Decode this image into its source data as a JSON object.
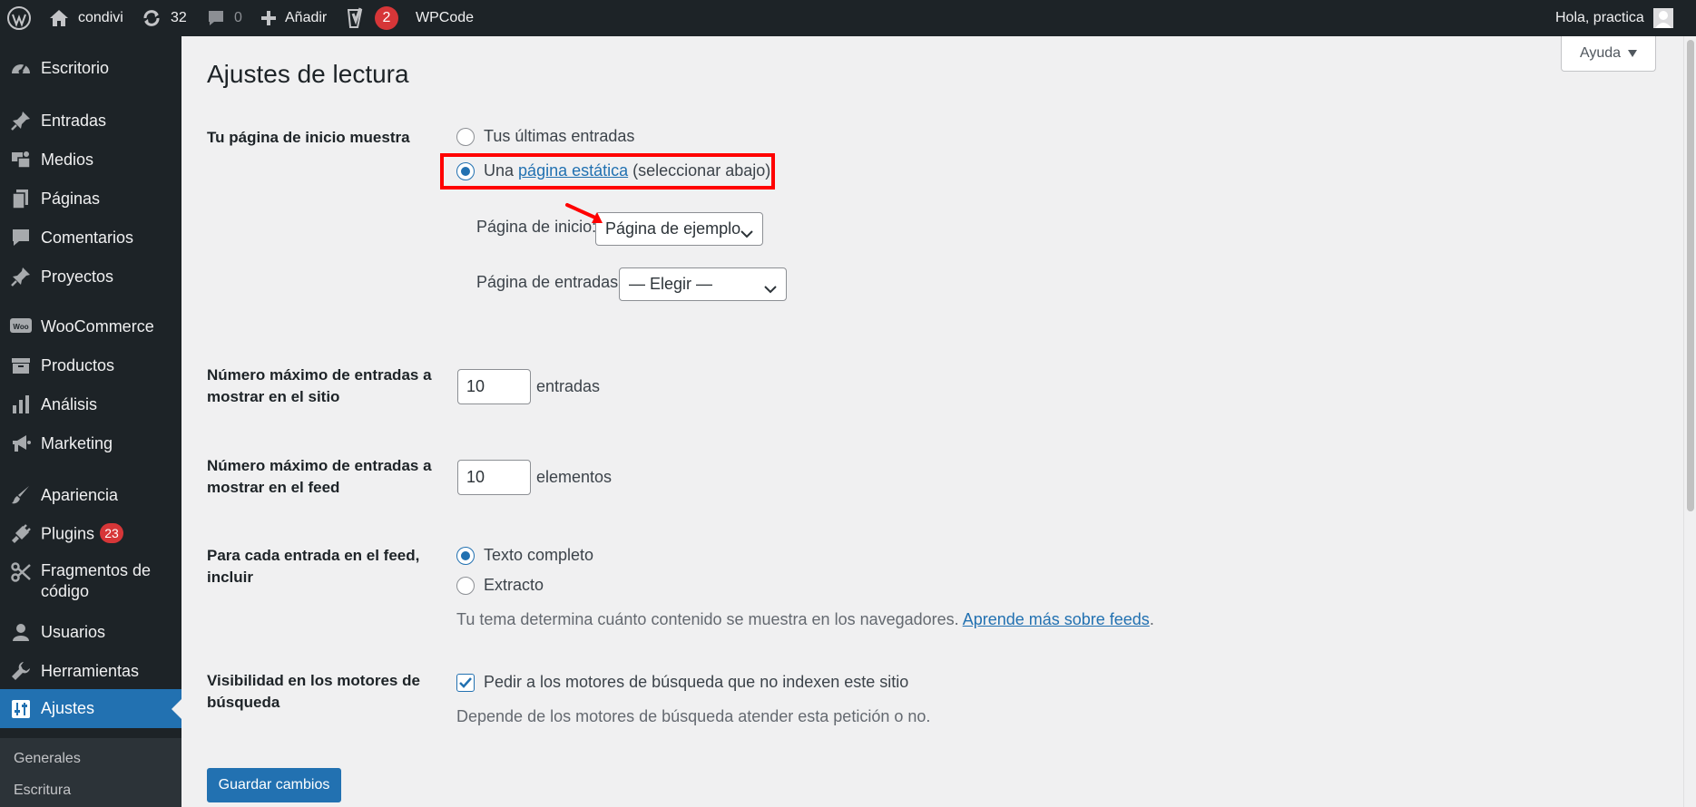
{
  "adminbar": {
    "site_name": "condivi",
    "updates_count": "32",
    "comments_count": "0",
    "add_new": "Añadir",
    "yoast_count": "2",
    "wpcode": "WPCode",
    "greeting": "Hola, practica"
  },
  "sidebar": {
    "items": [
      {
        "label": "Escritorio",
        "icon": "dashboard-icon"
      },
      {
        "label": "Entradas",
        "icon": "pin-icon"
      },
      {
        "label": "Medios",
        "icon": "media-icon"
      },
      {
        "label": "Páginas",
        "icon": "pages-icon"
      },
      {
        "label": "Comentarios",
        "icon": "comment-icon"
      },
      {
        "label": "Proyectos",
        "icon": "pin-icon"
      },
      {
        "label": "WooCommerce",
        "icon": "woo-icon"
      },
      {
        "label": "Productos",
        "icon": "archive-icon"
      },
      {
        "label": "Análisis",
        "icon": "bar-chart-icon"
      },
      {
        "label": "Marketing",
        "icon": "megaphone-icon"
      },
      {
        "label": "Apariencia",
        "icon": "brush-icon"
      },
      {
        "label": "Plugins",
        "icon": "plugin-icon",
        "badge": "23"
      },
      {
        "label": "Fragmentos de código",
        "icon": "code-snippets-icon"
      },
      {
        "label": "Usuarios",
        "icon": "user-icon"
      },
      {
        "label": "Herramientas",
        "icon": "wrench-icon"
      },
      {
        "label": "Ajustes",
        "icon": "settings-icon",
        "current": true
      }
    ],
    "submenu": [
      "Generales",
      "Escritura"
    ]
  },
  "page": {
    "title": "Ajustes de lectura",
    "help": "Ayuda",
    "front_page": {
      "label": "Tu página de inicio muestra",
      "option_latest": "Tus últimas entradas",
      "option_static_prefix": "Una",
      "option_static_link": "página estática",
      "option_static_suffix": "(seleccionar abajo)",
      "homepage_label": "Página de inicio:",
      "homepage_value": "Página de ejemplo",
      "postspage_label": "Página de entradas:",
      "postspage_value": "— Elegir —"
    },
    "posts_per_page": {
      "label": "Número máximo de entradas a mostrar en el sitio",
      "value": "10",
      "unit": "entradas"
    },
    "posts_per_rss": {
      "label": "Número máximo de entradas a mostrar en el feed",
      "value": "10",
      "unit": "elementos"
    },
    "rss_use_excerpt": {
      "label": "Para cada entrada en el feed, incluir",
      "option_full": "Texto completo",
      "option_excerpt": "Extracto",
      "desc_prefix": "Tu tema determina cuánto contenido se muestra en los navegadores.",
      "desc_link": "Aprende más sobre feeds",
      "desc_suffix": "."
    },
    "visibility": {
      "label": "Visibilidad en los motores de búsqueda",
      "checkbox_label": "Pedir a los motores de búsqueda que no indexen este sitio",
      "desc": "Depende de los motores de búsqueda atender esta petición o no."
    },
    "save": "Guardar cambios"
  },
  "colors": {
    "adminbar_bg": "#1d2327",
    "accent": "#2271b1",
    "badge": "#d63638",
    "annotation": "#ff0000"
  }
}
